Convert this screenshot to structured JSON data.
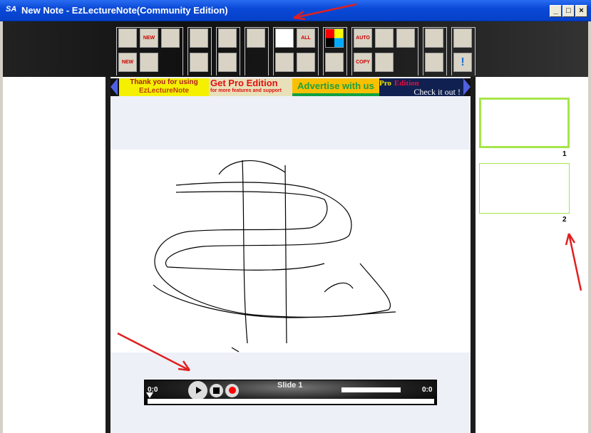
{
  "window": {
    "title": "New Note - EzLectureNote(Community Edition)",
    "icon": "SA",
    "minimize": "_",
    "maximize": "□",
    "close": "×"
  },
  "toolbar": {
    "buttons": [
      {
        "name": "open-icon",
        "label": ""
      },
      {
        "name": "new-icon",
        "label": "NEW"
      },
      {
        "name": "delete-shape-icon",
        "label": ""
      },
      {
        "name": "new-note-icon",
        "label": "NEW"
      },
      {
        "name": "shapes-icon",
        "label": ""
      },
      {
        "name": "save-icon",
        "label": ""
      },
      {
        "name": "save-as-icon",
        "label": ""
      },
      {
        "name": "undo-icon",
        "label": ""
      },
      {
        "name": "redo-icon",
        "label": ""
      },
      {
        "name": "palette-icon",
        "label": ""
      },
      {
        "name": "pen-icon",
        "label": ""
      },
      {
        "name": "erase-all-icon",
        "label": "ALL"
      },
      {
        "name": "eraser-icon",
        "label": ""
      },
      {
        "name": "undo-erase-icon",
        "label": ""
      },
      {
        "name": "color-picker-icon",
        "label": ""
      },
      {
        "name": "line-width-icon",
        "label": ""
      },
      {
        "name": "auto-copy-icon",
        "label": "AUTO COPY"
      },
      {
        "name": "layers-icon",
        "label": ""
      },
      {
        "name": "shapes-tool-icon",
        "label": ""
      },
      {
        "name": "copy-icon",
        "label": "COPY"
      },
      {
        "name": "paste-shapes-icon",
        "label": ""
      },
      {
        "name": "swap-icon",
        "label": ""
      },
      {
        "name": "move-icon",
        "label": ""
      },
      {
        "name": "settings-icon",
        "label": ""
      },
      {
        "name": "about-icon",
        "label": "!"
      }
    ]
  },
  "ads": {
    "thank1": "Thank you for using",
    "thank2": "EzLectureNote",
    "pro1": "Get Pro Edition",
    "pro2": "for more features and support",
    "advertise": "Advertise with us",
    "proed1": "Pro",
    "proed2": "Edition",
    "check": "Check it out !"
  },
  "player": {
    "slide": "Slide 1",
    "time_start": "0:0",
    "time_end": "0:0"
  },
  "thumbnails": [
    {
      "number": "1"
    },
    {
      "number": "2"
    }
  ],
  "colors": {
    "accent": "#a6e64a",
    "title": "#0a4ad8"
  }
}
